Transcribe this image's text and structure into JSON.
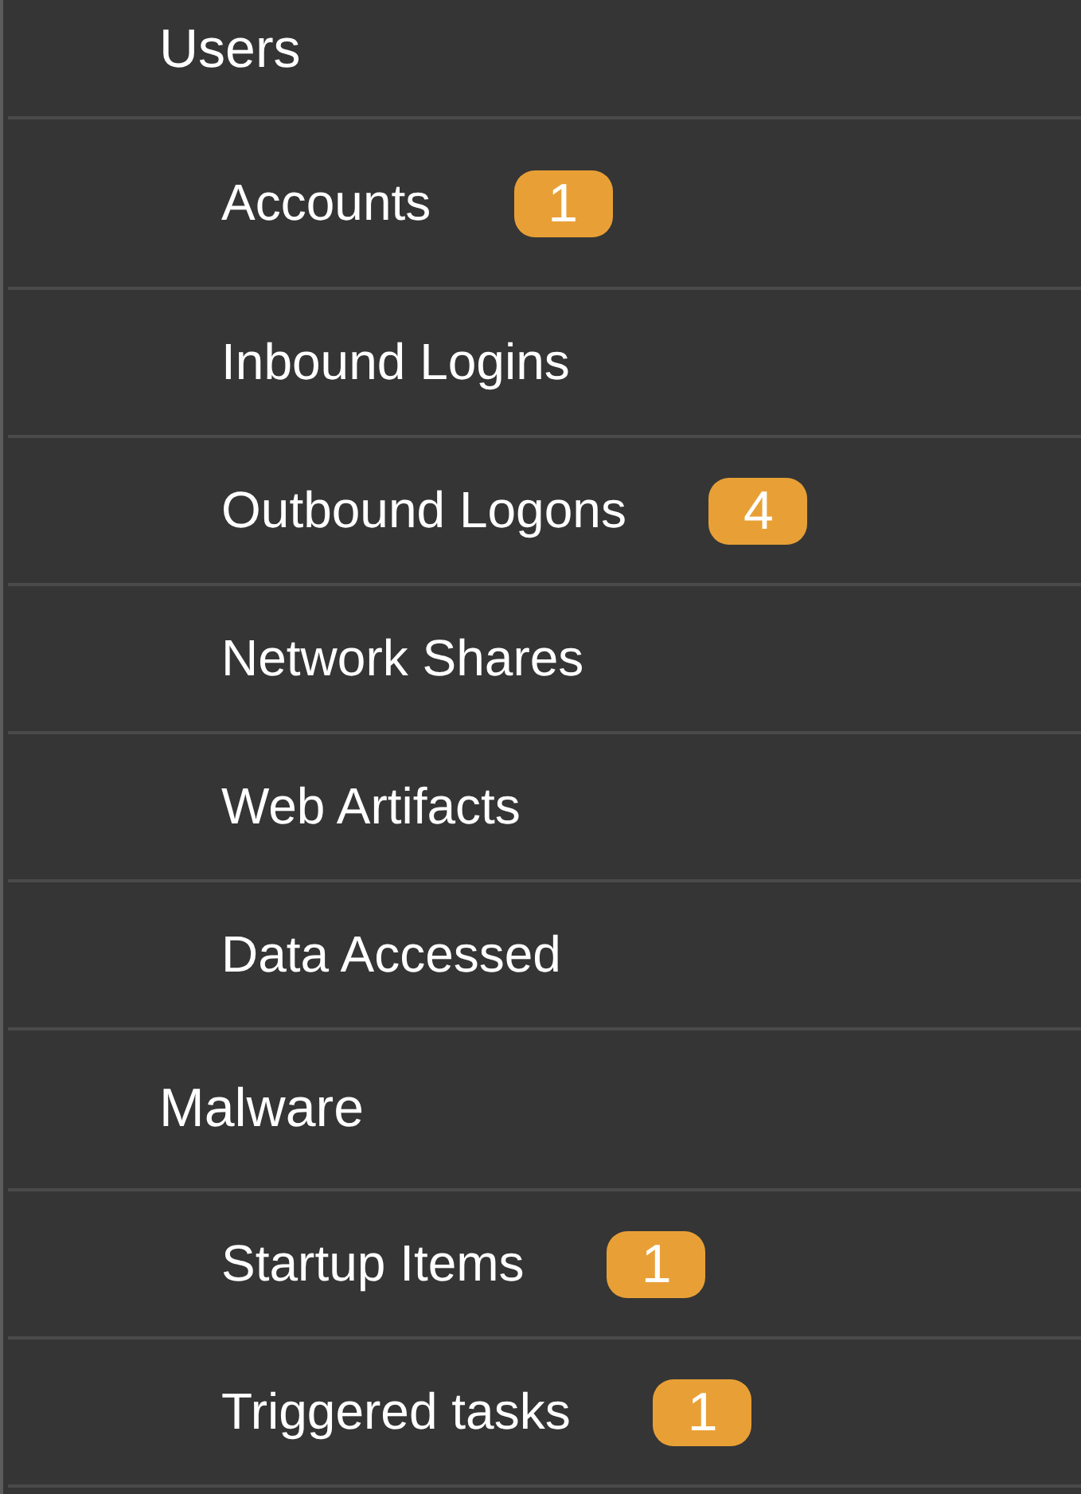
{
  "sidebar": {
    "sections": [
      {
        "label": "Users",
        "children": [
          {
            "label": "Accounts",
            "badge": "1"
          },
          {
            "label": "Inbound Logins"
          },
          {
            "label": "Outbound Logons",
            "badge": "4"
          },
          {
            "label": "Network Shares"
          },
          {
            "label": "Web Artifacts"
          },
          {
            "label": "Data Accessed"
          }
        ]
      },
      {
        "label": "Malware",
        "children": [
          {
            "label": "Startup Items",
            "badge": "1"
          },
          {
            "label": "Triggered tasks",
            "badge": "1"
          }
        ]
      }
    ]
  }
}
